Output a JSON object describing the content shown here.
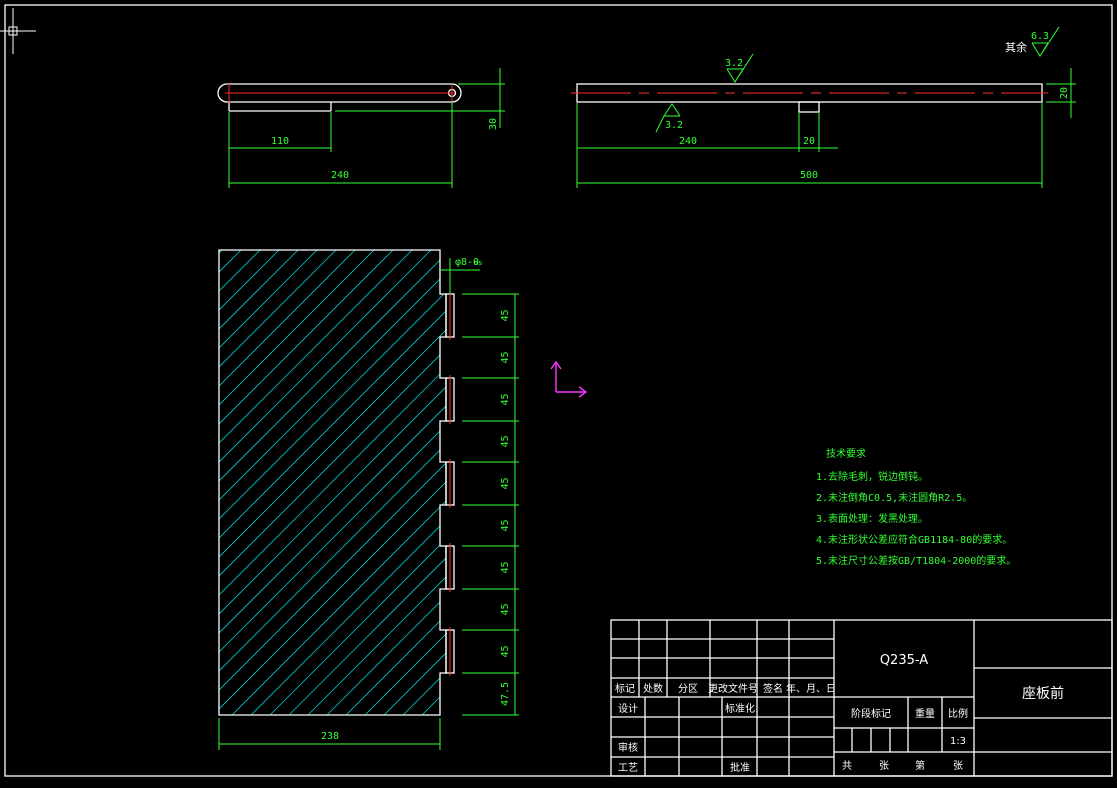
{
  "colors": {
    "background": "#000000",
    "outline": "#ffffff",
    "dimension": "#33ff33",
    "centerline": "#ff2a2a",
    "hatch": "#00cccc",
    "ucs": "#ff33ff"
  },
  "top_view_left": {
    "dim_110": "110",
    "dim_240": "240",
    "dim_30": "30"
  },
  "top_view_right": {
    "roughness_top": "3.2",
    "roughness_bottom": "3.2",
    "dim_240": "240",
    "dim_20_slot": "20",
    "dim_500": "500",
    "dim_20_height": "20",
    "rest_label": "其余",
    "rest_roughness": "6.3"
  },
  "main_view": {
    "pitch_labels": [
      "45",
      "45",
      "45",
      "45",
      "45",
      "45",
      "45",
      "45",
      "45",
      "47.5"
    ],
    "width_label": "238",
    "fit_label": "φ8-0",
    "fit_suffix": "ms"
  },
  "tech_requirements": {
    "title": "技术要求",
    "items": [
      "1.去除毛刺，锐边倒钝。",
      "2.未注倒角C0.5,未注圆角R2.5。",
      "3.表面处理：发黑处理。",
      "4.未注形状公差应符合GB1184-80的要求。",
      "5.未注尺寸公差按GB/T1804-2000的要求。"
    ]
  },
  "title_block": {
    "material": "Q235-A",
    "part_name": "座板前",
    "header_row": [
      "标记",
      "处数",
      "分区",
      "更改文件号",
      "签名",
      "年、月、日"
    ],
    "design": "设计",
    "standardize": "标准化",
    "review": "审核",
    "process": "工艺",
    "approve": "批准",
    "stage_mark": "阶段标记",
    "weight": "重量",
    "scale_label": "比例",
    "scale_value": "1:3",
    "total": "共",
    "sheets1": "张",
    "page": "第",
    "sheets2": "张"
  }
}
